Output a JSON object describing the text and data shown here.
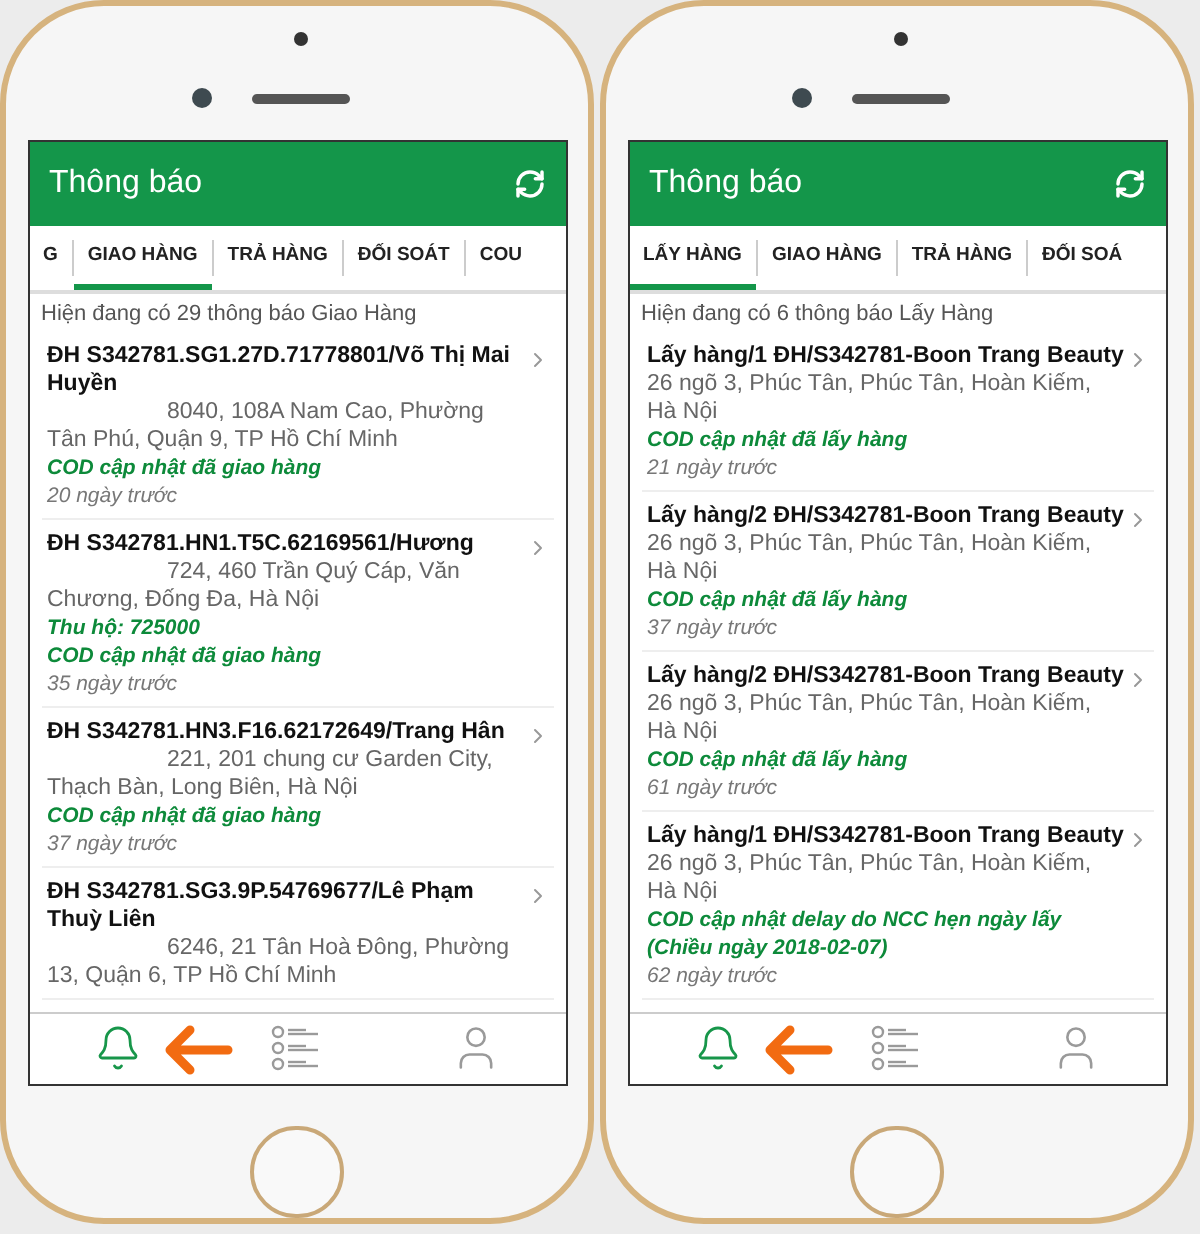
{
  "phones": [
    {
      "header": {
        "title": "Thông báo"
      },
      "tabs": [
        {
          "label": "G",
          "selected": false
        },
        {
          "label": "GIAO HÀNG",
          "selected": true
        },
        {
          "label": "TRẢ HÀNG",
          "selected": false
        },
        {
          "label": "ĐỐI SOÁT",
          "selected": false
        },
        {
          "label": "COU",
          "selected": false
        }
      ],
      "summary": "Hiện đang có 29 thông báo Giao Hàng",
      "notifications": [
        {
          "title": "ĐH S342781.SG1.27D.71778801/Võ Thị Mai Huyền",
          "address": "8040, 108A Nam Cao, Phường Tân Phú, Quận 9, TP Hồ Chí Minh",
          "indented": true,
          "status": "COD cập nhật đã giao hàng",
          "time": "20 ngày trước"
        },
        {
          "title": "ĐH S342781.HN1.T5C.62169561/Hương",
          "address": "724, 460 Trần Quý Cáp, Văn Chương, Đống Đa, Hà Nội",
          "indented": true,
          "cod_amount": "Thu hộ: 725000",
          "status": "COD cập nhật đã giao hàng",
          "time": "35 ngày trước"
        },
        {
          "title": "ĐH S342781.HN3.F16.62172649/Trang Hân",
          "address": "221, 201 chung cư Garden City, Thạch Bàn, Long Biên, Hà Nội",
          "indented": true,
          "status": "COD cập nhật đã giao hàng",
          "time": "37 ngày trước"
        },
        {
          "title": "ĐH S342781.SG3.9P.54769677/Lê Phạm Thuỳ Liên",
          "address": "6246, 21 Tân Hoà Đông, Phường 13, Quận 6, TP Hồ Chí Minh",
          "indented": true
        }
      ],
      "nav": [
        {
          "kind": "bell",
          "selected": true
        },
        {
          "kind": "list",
          "selected": false
        },
        {
          "kind": "user",
          "selected": false
        }
      ]
    },
    {
      "header": {
        "title": "Thông báo"
      },
      "tabs": [
        {
          "label": "LẤY HÀNG",
          "selected": true
        },
        {
          "label": "GIAO HÀNG",
          "selected": false
        },
        {
          "label": "TRẢ HÀNG",
          "selected": false
        },
        {
          "label": "ĐỐI SOÁ",
          "selected": false
        }
      ],
      "summary": "Hiện đang có 6 thông báo Lấy Hàng",
      "notifications": [
        {
          "title": "Lấy hàng/1 ĐH/S342781-Boon Trang Beauty",
          "address": "26 ngõ 3, Phúc Tân, Phúc Tân, Hoàn Kiếm, Hà Nội",
          "indented": false,
          "status": "COD cập nhật đã lấy hàng",
          "time": "21 ngày trước"
        },
        {
          "title": "Lấy hàng/2 ĐH/S342781-Boon Trang Beauty",
          "address": "26 ngõ 3, Phúc Tân, Phúc Tân, Hoàn Kiếm, Hà Nội",
          "indented": false,
          "status": "COD cập nhật đã lấy hàng",
          "time": "37 ngày trước"
        },
        {
          "title": "Lấy hàng/2 ĐH/S342781-Boon Trang Beauty",
          "address": "26 ngõ 3, Phúc Tân, Phúc Tân, Hoàn Kiếm, Hà Nội",
          "indented": false,
          "status": "COD cập nhật đã lấy hàng",
          "time": "61 ngày trước"
        },
        {
          "title": "Lấy hàng/1 ĐH/S342781-Boon Trang Beauty",
          "address": "26 ngõ 3, Phúc Tân, Phúc Tân, Hoàn Kiếm, Hà Nội",
          "indented": false,
          "status": "COD cập nhật delay do NCC hẹn ngày lấy (Chiều ngày 2018-02-07)",
          "time": "62 ngày trước"
        }
      ],
      "nav": [
        {
          "kind": "bell",
          "selected": true
        },
        {
          "kind": "list",
          "selected": false
        },
        {
          "kind": "user",
          "selected": false
        }
      ]
    }
  ]
}
